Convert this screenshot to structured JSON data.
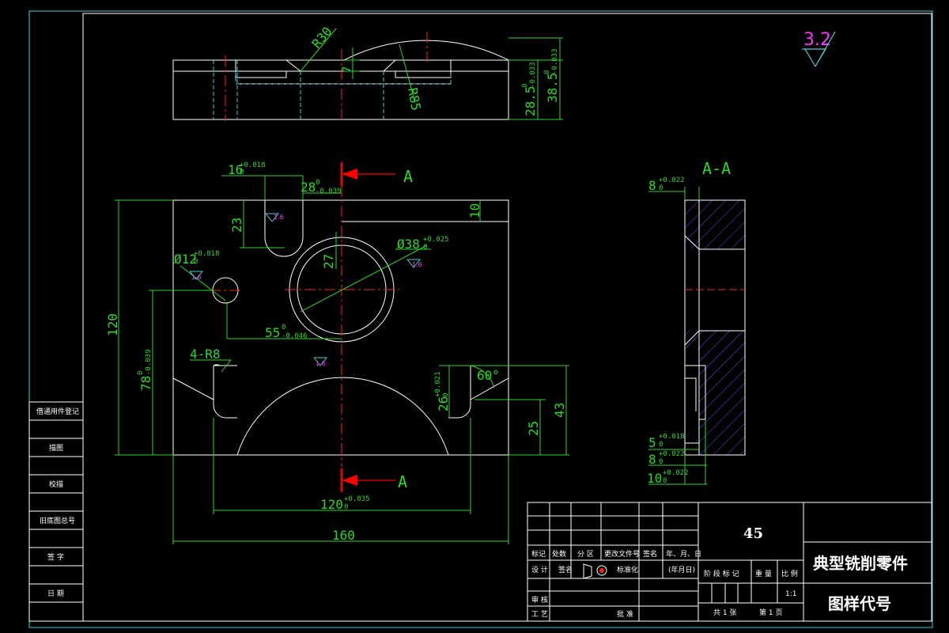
{
  "drawing": {
    "roughness_symbol": "3.2",
    "top_view": {
      "r30": "R30",
      "r85": "R85",
      "d7": "7",
      "h285": "28.5",
      "h285_tol_upper": "0",
      "h285_tol_lower": "-0.033",
      "h385": "38.5",
      "h385_tol_upper": "0",
      "h385_tol_lower": "-0.033"
    },
    "front_view": {
      "slot16": "16",
      "slot16_tol_upper": "+0.018",
      "slot16_tol_lower": "0",
      "d28": "28",
      "d28_tol_upper": "0",
      "d28_tol_lower": "-0.039",
      "d10": "10",
      "d23": "23",
      "d27": "27",
      "dia38": "Ø38",
      "dia38_tol_upper": "+0.025",
      "dia38_tol_lower": "0",
      "dia12": "Ø12",
      "dia12_tol_upper": "+0.018",
      "dia12_tol_lower": "0",
      "ra16": "1.6",
      "d120v": "120",
      "d78": "78",
      "d78_tol_upper": "0",
      "d78_tol_lower": "-0.039",
      "d55": "55",
      "d55_tol_upper": "0",
      "d55_tol_lower": "-0.046",
      "r8": "4-R8",
      "d26": "26",
      "d26_tol_upper": "+0.021",
      "d26_tol_lower": "0",
      "angle60": "60°",
      "d43": "43",
      "d25": "25",
      "d120h": "120",
      "d120h_tol_upper": "+0.035",
      "d120h_tol_lower": "0",
      "d160": "160",
      "section_a_top": "A",
      "section_a_bottom": "A"
    },
    "section_view": {
      "title": "A-A",
      "d8top": "8",
      "d8top_tol_upper": "+0.022",
      "d8top_tol_lower": "0",
      "d5": "5",
      "d5_tol_upper": "+0.018",
      "d5_tol_lower": "0",
      "d8b": "8",
      "d8b_tol_upper": "+0.022",
      "d8b_tol_lower": "0",
      "d10b": "10",
      "d10b_tol_upper": "+0.022",
      "d10b_tol_lower": "0"
    }
  },
  "side_table": {
    "rows": [
      "借通用件登记",
      "描图",
      "校描",
      "旧底图总号",
      "签 字",
      "日 期"
    ]
  },
  "title_block": {
    "material": "45",
    "part_name": "典型铣削零件",
    "drawing_no": "图样代号",
    "col_marks": "标记",
    "col_count": "处数",
    "col_zone": "分 区",
    "col_docno": "更改文件号",
    "col_sign": "签名",
    "col_date": "年、月、日",
    "design": "设 计",
    "sign2": "签名",
    "standardize": "标准化",
    "date_ymd": "(年月日)",
    "stage_mark": "阶 段 标 记",
    "weight": "重 量",
    "scale": "比 例",
    "scale_value": "1:1",
    "review": "审 核",
    "process": "工 艺",
    "approve": "批 准",
    "sheets_total": "共 1 张",
    "sheet_no": "第 1 页"
  }
}
